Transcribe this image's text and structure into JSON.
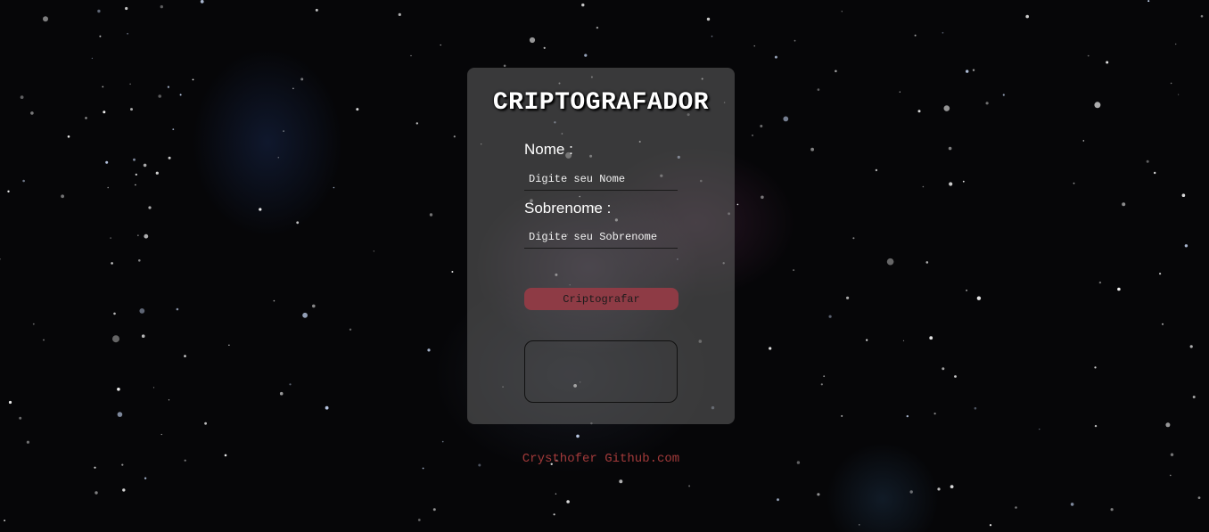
{
  "card": {
    "title": "CRIPTOGRAFADOR",
    "nome_label": "Nome :",
    "nome_placeholder": "Digite seu Nome",
    "sobrenome_label": "Sobrenome :",
    "sobrenome_placeholder": "Digite seu Sobrenome",
    "button_label": "Criptografar",
    "result_value": ""
  },
  "footer": {
    "link_text": "Crysthofer Github.com"
  },
  "colors": {
    "button": "#8e3b45",
    "footer_link": "#a33a3a",
    "card": "rgba(100,100,100,0.55)"
  }
}
